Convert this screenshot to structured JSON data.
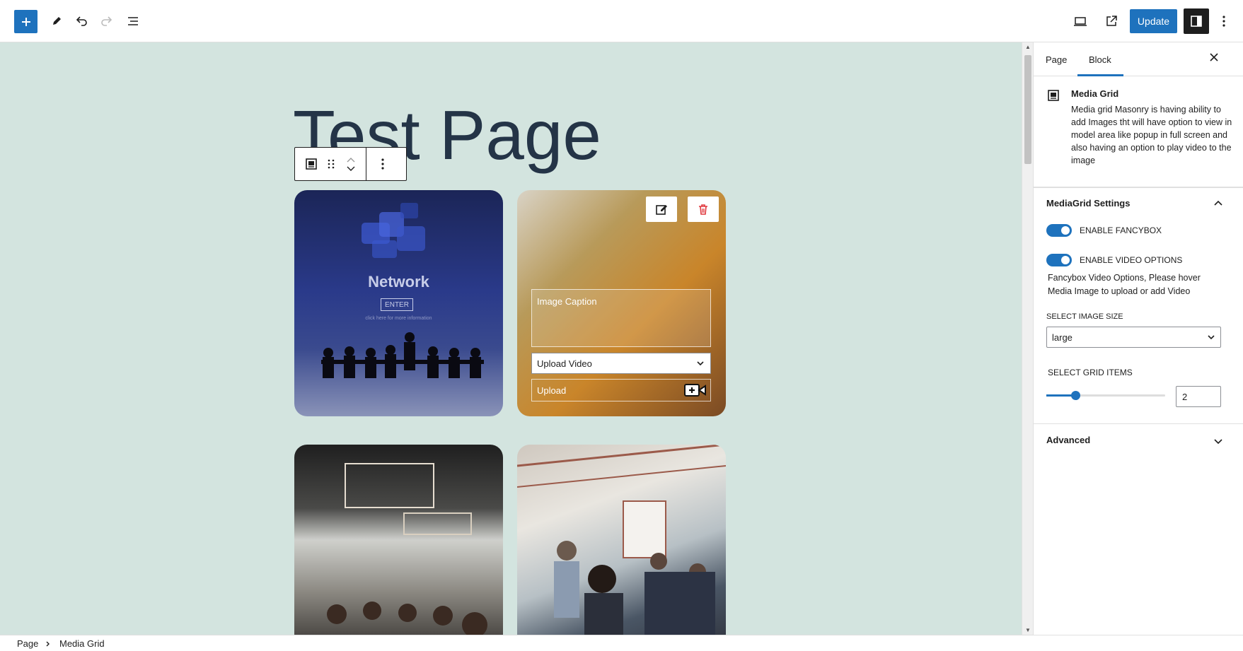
{
  "toolbar": {
    "add_block_icon": "plus-icon",
    "tools_icon": "pencil-icon",
    "undo_icon": "undo-icon",
    "redo_icon": "redo-icon",
    "list_view_icon": "list-view-icon",
    "view_icon": "desktop-icon",
    "preview_icon": "external-link-icon",
    "update_label": "Update",
    "settings_icon": "sidebar-toggle-icon",
    "options_icon": "more-vertical-icon"
  },
  "canvas": {
    "page_title": "Test Page",
    "block_toolbar": {
      "block_icon": "media-grid-icon",
      "drag_icon": "drag-handle-icon",
      "move_up_icon": "chevron-up-icon",
      "move_down_icon": "chevron-down-icon",
      "options_icon": "more-vertical-icon"
    },
    "cards": [
      {
        "name": "Network",
        "image_text": "Network",
        "enter_text": "ENTER",
        "small_text": "click here for more information"
      },
      {
        "edit_icon": "edit-image-icon",
        "delete_icon": "trash-icon",
        "caption_placeholder": "Image Caption",
        "upload_select_value": "Upload Video",
        "upload_label": "Upload",
        "video_icon": "add-video-icon"
      },
      {},
      {}
    ]
  },
  "sidebar": {
    "tabs": [
      "Page",
      "Block"
    ],
    "active_tab": "Block",
    "close_icon": "close-icon",
    "block": {
      "icon": "media-grid-icon",
      "title": "Media Grid",
      "description": "Media grid Masonry is having ability to add Images tht will have option to view in model area like popup in full screen and also having an option to play video to the image"
    },
    "settings_panel": {
      "title": "MediaGrid Settings",
      "toggle_fancybox": {
        "label": "ENABLE FANCYBOX",
        "checked": true
      },
      "toggle_video": {
        "label": "ENABLE VIDEO OPTIONS",
        "checked": true
      },
      "help": "Fancybox Video Options, Please hover Media Image to upload or add Video",
      "image_size_label": "SELECT IMAGE SIZE",
      "image_size_value": "large",
      "grid_items_label": "SELECT GRID ITEMS",
      "grid_items_value": "2"
    },
    "advanced_panel": {
      "title": "Advanced"
    }
  },
  "footer": {
    "breadcrumb": [
      "Page",
      "Media Grid"
    ]
  }
}
